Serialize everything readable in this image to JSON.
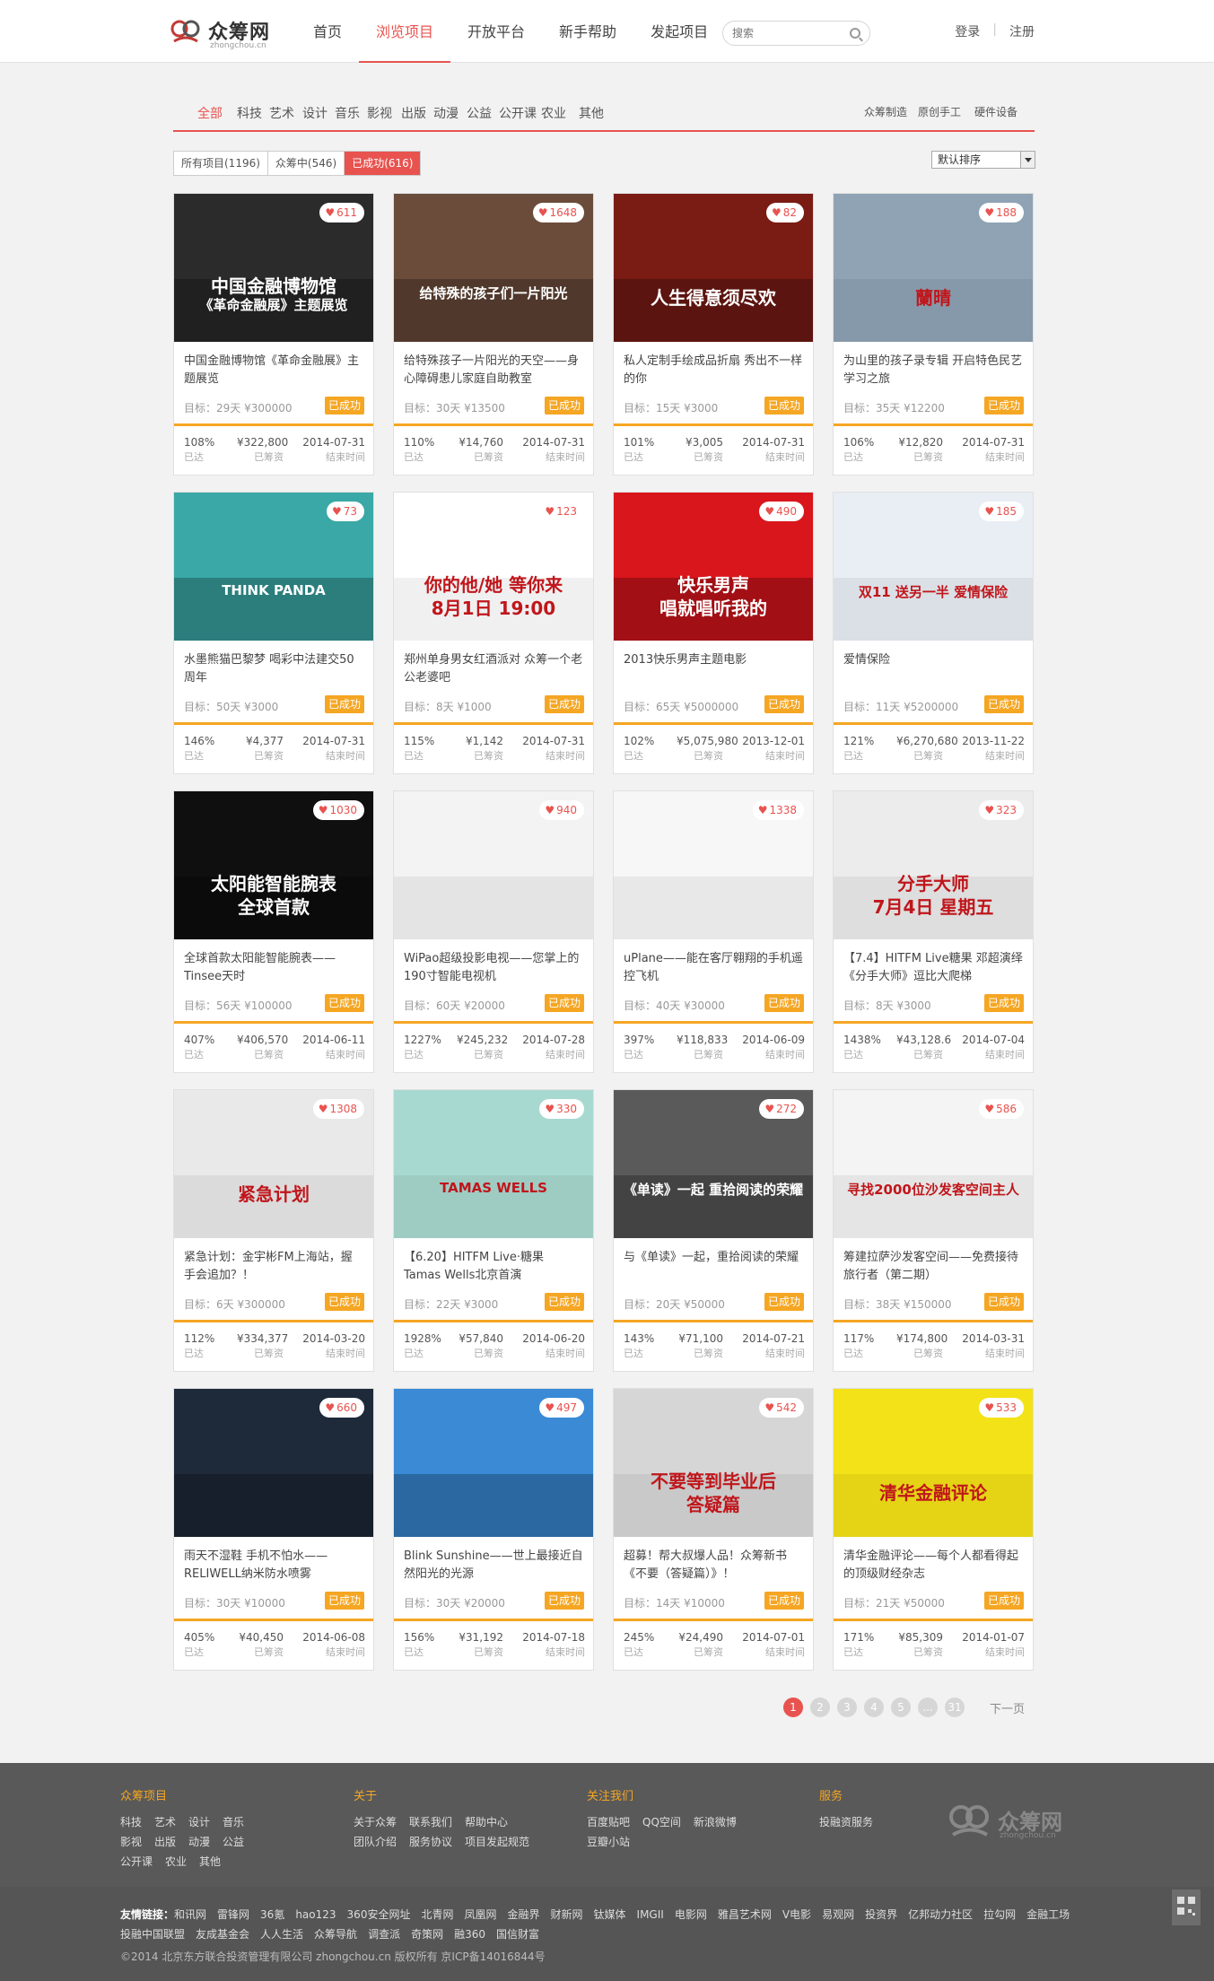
{
  "site": {
    "name": "众筹网",
    "domain": "zhongchou.cn"
  },
  "nav": {
    "items": [
      "首页",
      "浏览项目",
      "开放平台",
      "新手帮助",
      "发起项目"
    ],
    "active": 1
  },
  "search": {
    "placeholder": "搜索"
  },
  "auth": {
    "login": "登录",
    "sep": "|",
    "register": "注册"
  },
  "categories": [
    "全部",
    "科技",
    "艺术",
    "设计",
    "音乐",
    "影视",
    "出版",
    "动漫",
    "公益",
    "公开课",
    "农业",
    "其他"
  ],
  "subcategories": [
    "众筹制造",
    "原创手工",
    "硬件设备"
  ],
  "status_tabs": [
    "所有项目(1196)",
    "众筹中(546)",
    "已成功(616)"
  ],
  "sort": {
    "selected": "默认排序"
  },
  "labels": {
    "reached": "已达",
    "raised": "已筹资",
    "end": "结束时间"
  },
  "cards": [
    {
      "likes": "611",
      "title": "中国金融博物馆《革命金融展》主题展览",
      "goal": "目标：29天 ¥300000",
      "badge": "已成功",
      "pct": "108%",
      "amount": "¥322,800",
      "date": "2014-07-31",
      "thumb_text": "中国金融博物馆\n《革命金融展》主题展览",
      "color": "#2b2b2b"
    },
    {
      "likes": "1648",
      "title": "给特殊孩子一片阳光的天空——身心障碍患儿家庭自助教室",
      "goal": "目标：30天 ¥13500",
      "badge": "已成功",
      "pct": "110%",
      "amount": "¥14,760",
      "date": "2014-07-31",
      "thumb_text": "给特殊的孩子们一片阳光",
      "color": "#6b4c3b"
    },
    {
      "likes": "82",
      "title": "私人定制手绘成品折扇 秀出不一样的你",
      "goal": "目标：15天 ¥3000",
      "badge": "已成功",
      "pct": "101%",
      "amount": "¥3,005",
      "date": "2014-07-31",
      "thumb_text": "人生得意须尽欢",
      "color": "#7a1b14"
    },
    {
      "likes": "188",
      "title": "为山里的孩子录专辑 开启特色民艺学习之旅",
      "goal": "目标：35天 ¥12200",
      "badge": "已成功",
      "pct": "106%",
      "amount": "¥12,820",
      "date": "2014-07-31",
      "thumb_text": "蘭晴",
      "color": "#8fa3b5"
    },
    {
      "likes": "73",
      "title": "水墨熊猫巴黎梦 喝彩中法建交50周年",
      "goal": "目标：50天 ¥3000",
      "badge": "已成功",
      "pct": "146%",
      "amount": "¥4,377",
      "date": "2014-07-31",
      "thumb_text": "THINK PANDA",
      "color": "#3aa8a6"
    },
    {
      "likes": "123",
      "title": "郑州单身男女红酒派对 众筹一个老公老婆吧",
      "goal": "目标：8天 ¥1000",
      "badge": "已成功",
      "pct": "115%",
      "amount": "¥1,142",
      "date": "2014-07-31",
      "thumb_text": "你的他/她 等你来\n8月1日 19:00",
      "color": "#ffffff"
    },
    {
      "likes": "490",
      "title": "2013快乐男声主题电影",
      "goal": "目标：65天 ¥5000000",
      "badge": "已成功",
      "pct": "102%",
      "amount": "¥5,075,980",
      "date": "2013-12-01",
      "thumb_text": "快乐男声\n唱就唱听我的",
      "color": "#d9161c"
    },
    {
      "likes": "185",
      "title": "爱情保险",
      "goal": "目标：11天 ¥5200000",
      "badge": "已成功",
      "pct": "121%",
      "amount": "¥6,270,680",
      "date": "2013-11-22",
      "thumb_text": "双11 送另一半 爱情保险",
      "color": "#e9eef5"
    },
    {
      "likes": "1030",
      "title": "全球首款太阳能智能腕表——Tinsee天时",
      "goal": "目标：56天 ¥100000",
      "badge": "已成功",
      "pct": "407%",
      "amount": "¥406,570",
      "date": "2014-06-11",
      "thumb_text": "太阳能智能腕表\n全球首款",
      "color": "#0f0f0f"
    },
    {
      "likes": "940",
      "title": "WiPao超级投影电视——您掌上的190寸智能电视机",
      "goal": "目标：60天 ¥20000",
      "badge": "已成功",
      "pct": "1227%",
      "amount": "¥245,232",
      "date": "2014-07-28",
      "thumb_text": "",
      "color": "#f3f3f3"
    },
    {
      "likes": "1338",
      "title": "uPlane——能在客厅翱翔的手机遥控飞机",
      "goal": "目标：40天 ¥30000",
      "badge": "已成功",
      "pct": "397%",
      "amount": "¥118,833",
      "date": "2014-06-09",
      "thumb_text": "",
      "color": "#f7f7f7"
    },
    {
      "likes": "323",
      "title": "【7.4】HITFM Live糖果 邓超演绎《分手大师》逗比大爬梯",
      "goal": "目标：8天 ¥3000",
      "badge": "已成功",
      "pct": "1438%",
      "amount": "¥43,128.6",
      "date": "2014-07-04",
      "thumb_text": "分手大师\n7月4日 星期五",
      "color": "#ececec"
    },
    {
      "likes": "1308",
      "title": "紧急计划：金宇彬FM上海站，握手会追加？！",
      "goal": "目标：6天 ¥300000",
      "badge": "已成功",
      "pct": "112%",
      "amount": "¥334,377",
      "date": "2014-03-20",
      "thumb_text": "紧急计划",
      "color": "#e9e9e9"
    },
    {
      "likes": "330",
      "title": "【6.20】HITFM Live·糖果 Tamas Wells北京首演",
      "goal": "目标：22天 ¥3000",
      "badge": "已成功",
      "pct": "1928%",
      "amount": "¥57,840",
      "date": "2014-06-20",
      "thumb_text": "TAMAS WELLS",
      "color": "#a8d9d0"
    },
    {
      "likes": "272",
      "title": "与《单读》一起，重拾阅读的荣耀",
      "goal": "目标：20天 ¥50000",
      "badge": "已成功",
      "pct": "143%",
      "amount": "¥71,100",
      "date": "2014-07-21",
      "thumb_text": "《单读》一起 重拾阅读的荣耀",
      "color": "#5a5a5a"
    },
    {
      "likes": "586",
      "title": "筹建拉萨沙发客空间——免费接待旅行者（第二期）",
      "goal": "目标：38天 ¥150000",
      "badge": "已成功",
      "pct": "117%",
      "amount": "¥174,800",
      "date": "2014-03-31",
      "thumb_text": "寻找2000位沙发客空间主人",
      "color": "#f4f4f4"
    },
    {
      "likes": "660",
      "title": "雨天不湿鞋 手机不怕水——RELIWELL纳米防水喷雾",
      "goal": "目标：30天 ¥10000",
      "badge": "已成功",
      "pct": "405%",
      "amount": "¥40,450",
      "date": "2014-06-08",
      "thumb_text": "",
      "color": "#1e2a3a"
    },
    {
      "likes": "497",
      "title": "Blink Sunshine——世上最接近自然阳光的光源",
      "goal": "目标：30天 ¥20000",
      "badge": "已成功",
      "pct": "156%",
      "amount": "¥31,192",
      "date": "2014-07-18",
      "thumb_text": "",
      "color": "#3a8ad6"
    },
    {
      "likes": "542",
      "title": "超募！帮大叔爆人品！众筹新书《不要（答疑篇）》！",
      "goal": "目标：14天 ¥10000",
      "badge": "已成功",
      "pct": "245%",
      "amount": "¥24,490",
      "date": "2014-07-01",
      "thumb_text": "不要等到毕业后\n答疑篇",
      "color": "#d6d6d6"
    },
    {
      "likes": "533",
      "title": "清华金融评论——每个人都看得起的顶级财经杂志",
      "goal": "目标：21天 ¥50000",
      "badge": "已成功",
      "pct": "171%",
      "amount": "¥85,309",
      "date": "2014-01-07",
      "thumb_text": "清华金融评论",
      "color": "#f3e217"
    }
  ],
  "pagination": {
    "pages": [
      "1",
      "2",
      "3",
      "4",
      "5",
      "...",
      "31"
    ],
    "active": 0,
    "next": "下一页"
  },
  "footer": {
    "cols": [
      {
        "heading": "众筹项目",
        "links": [
          "科技",
          "艺术",
          "设计",
          "音乐",
          "影视",
          "出版",
          "动漫",
          "公益",
          "公开课",
          "农业",
          "其他"
        ]
      },
      {
        "heading": "关于",
        "links": [
          "关于众筹",
          "联系我们",
          "帮助中心",
          "团队介绍",
          "服务协议",
          "项目发起规范"
        ]
      },
      {
        "heading": "关注我们",
        "links": [
          "百度贴吧",
          "QQ空间",
          "新浪微博",
          "豆瓣小站"
        ]
      },
      {
        "heading": "服务",
        "links": [
          "投融资服务"
        ]
      }
    ],
    "friend_label": "友情链接：",
    "friend_links": [
      "和讯网",
      "雷锋网",
      "36氪",
      "hao123",
      "360安全网址",
      "北青网",
      "凤凰网",
      "金融界",
      "财新网",
      "钛媒体",
      "IMGII",
      "电影网",
      "雅昌艺术网",
      "V电影",
      "易观网",
      "投资界",
      "亿邦动力社区",
      "拉勾网",
      "金融工场",
      "投融中国联盟",
      "友成基金会",
      "人人生活",
      "众筹导航",
      "调查派",
      "奇策网",
      "融360",
      "国信财富"
    ],
    "copyright": "©2014 北京东方联合投资管理有限公司 zhongchou.cn 版权所有 京ICP备14016844号"
  }
}
